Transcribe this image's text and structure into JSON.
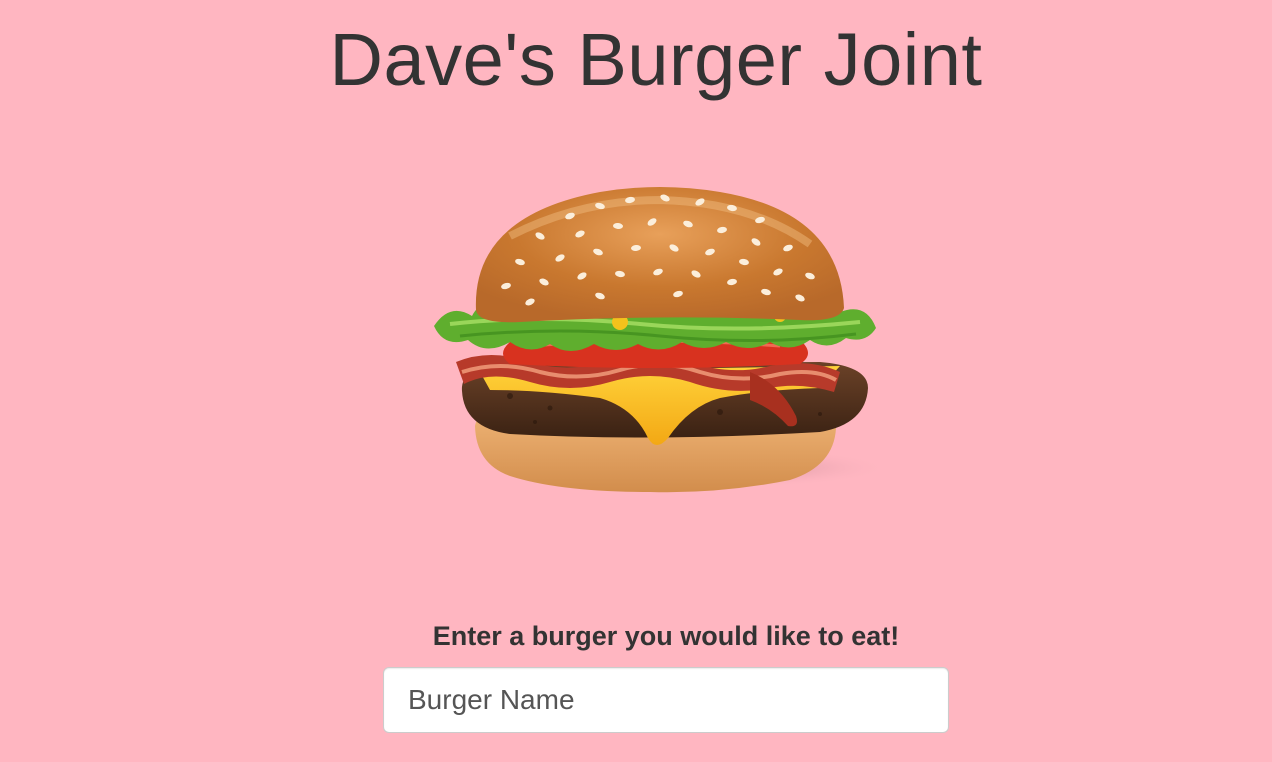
{
  "page": {
    "title": "Dave's Burger Joint",
    "background_color": "#ffb6c1",
    "text_color": "#333333"
  },
  "hero": {
    "image_subject": "burger-image",
    "alt": "Burger with bacon, cheese, lettuce, tomato on a sesame bun"
  },
  "form": {
    "label": "Enter a burger you would like to eat!",
    "input": {
      "placeholder": "Burger Name",
      "value": ""
    }
  }
}
